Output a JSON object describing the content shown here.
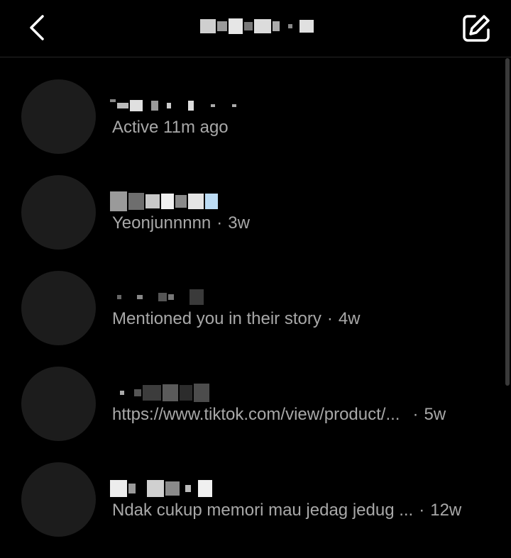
{
  "header": {
    "title": "",
    "back_icon": "chevron-left-icon",
    "compose_icon": "compose-icon"
  },
  "threads": [
    {
      "name": "",
      "preview": "Active 11m ago",
      "time": ""
    },
    {
      "name": "",
      "preview": "Yeonjunnnnn",
      "time": "3w"
    },
    {
      "name": "",
      "preview": "Mentioned you in their story",
      "time": "4w"
    },
    {
      "name": "",
      "preview": "https://www.tiktok.com/view/product/...",
      "time": "5w"
    },
    {
      "name": "",
      "preview": "Ndak cukup memori mau jedag jedug ...",
      "time": "12w"
    }
  ],
  "colors": {
    "background": "#000000",
    "secondary_text": "#a8a8a8",
    "avatar": "#1c1c1c"
  }
}
